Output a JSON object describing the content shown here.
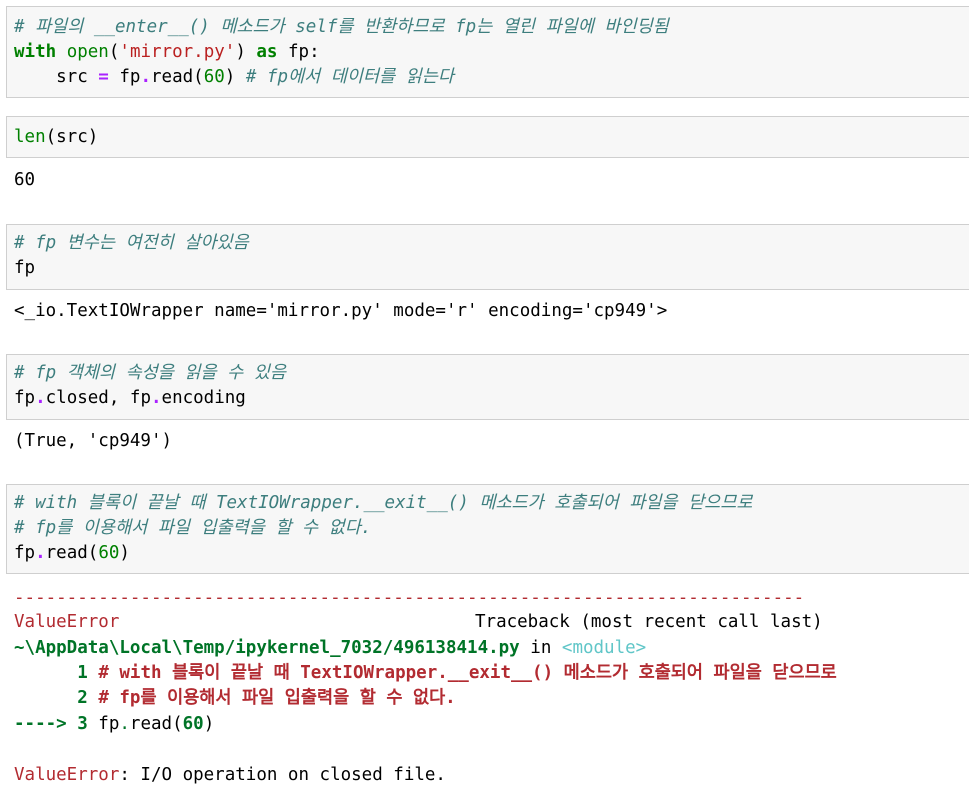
{
  "cells": [
    {
      "lines": [
        "# 파일의 __enter__() 메소드가 self를 반환하므로 fp는 열린 파일에 바인딩됨",
        "with open('mirror.py') as fp:",
        "    src = fp.read(60) # fp에서 데이터를 읽는다"
      ],
      "output": null
    },
    {
      "lines": [
        "len(src)"
      ],
      "output": "60"
    },
    {
      "lines": [
        "# fp 변수는 여전히 살아있음",
        "fp"
      ],
      "output": "<_io.TextIOWrapper name='mirror.py' mode='r' encoding='cp949'>"
    },
    {
      "lines": [
        "# fp 객체의 속성을 읽을 수 있음",
        "fp.closed, fp.encoding"
      ],
      "output": "(True, 'cp949')"
    },
    {
      "lines": [
        "# with 블록이 끝날 때 TextIOWrapper.__exit__() 메소드가 호출되어 파일을 닫으므로",
        "# fp를 이용해서 파일 입출력을 할 수 없다.",
        "fp.read(60)"
      ],
      "output": null
    }
  ],
  "traceback": {
    "separator": "---------------------------------------------------------------------------",
    "error_name": "ValueError",
    "header_right": "Traceback (most recent call last)",
    "path": "~\\AppData\\Local\\Temp/ipykernel_7032/496138414.py",
    "in_word": "in",
    "module": "<module>",
    "line1_no": "1",
    "line1_text": "# with 블록이 끝날 때 TextIOWrapper.__exit__() 메소드가 호출되어 파일을 닫으므로",
    "line2_no": "2",
    "line2_text": "# fp를 이용해서 파일 입출력을 할 수 없다.",
    "arrow": "----> 3",
    "line3_text": "fp.read(60)",
    "final_name": "ValueError",
    "final_msg": ": I/O operation on closed file."
  }
}
